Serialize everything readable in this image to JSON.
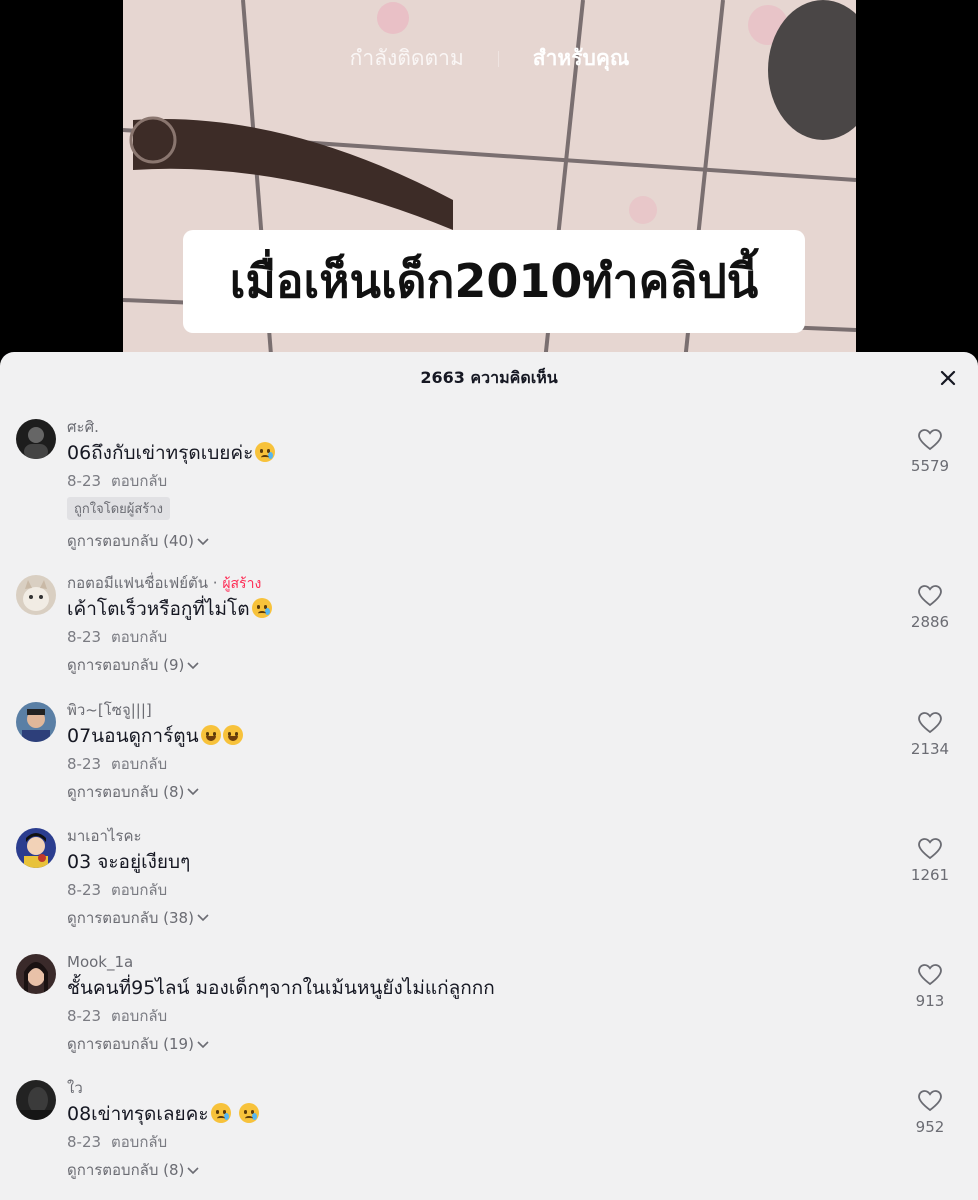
{
  "top_tabs": {
    "following": "กำลังติดตาม",
    "for_you": "สำหรับคุณ"
  },
  "video": {
    "caption": "เมื่อเห็นเด็ก2010ทำคลิปนี้"
  },
  "comments_panel": {
    "title": "2663 ความคิดเห็น",
    "comments": [
      {
        "username": "ศะศิ.",
        "creator": "",
        "text": "06ถึงกับเข่าทรุดเบยค่ะ",
        "emojis": [
          "crying-face"
        ],
        "date": "8-23",
        "reply_label": "ตอบกลับ",
        "badge": "ถูกใจโดยผู้สร้าง",
        "view_replies": "ดูการตอบกลับ (40)",
        "likes": "5579"
      },
      {
        "username": "กอตอมีแฟนชื่อเฟย์ตัน ·",
        "creator": "ผู้สร้าง",
        "text": "เค้าโตเร็วหรือกูที่ไม่โต",
        "emojis": [
          "crying-face"
        ],
        "date": "8-23",
        "reply_label": "ตอบกลับ",
        "badge": "",
        "view_replies": "ดูการตอบกลับ (9)",
        "likes": "2886"
      },
      {
        "username": "พิว~[โซจู|||]",
        "creator": "",
        "text": "07นอนดูการ์ตูน",
        "emojis": [
          "laughing-face",
          "laughing-face"
        ],
        "date": "8-23",
        "reply_label": "ตอบกลับ",
        "badge": "",
        "view_replies": "ดูการตอบกลับ (8)",
        "likes": "2134"
      },
      {
        "username": "มาเอาไรคะ",
        "creator": "",
        "text": "03 จะอยู่เงียบๆ",
        "emojis": [],
        "date": "8-23",
        "reply_label": "ตอบกลับ",
        "badge": "",
        "view_replies": "ดูการตอบกลับ (38)",
        "likes": "1261"
      },
      {
        "username": "Mook_1a",
        "creator": "",
        "text": "ชั้นคนที่95ไลน์ มองเด็กๆจากในเม้นหนูยังไม่แก่ลูกกก",
        "emojis": [],
        "date": "8-23",
        "reply_label": "ตอบกลับ",
        "badge": "",
        "view_replies": "ดูการตอบกลับ (19)",
        "likes": "913"
      },
      {
        "username": "ใว",
        "creator": "",
        "text": "08เข่าทรุดเลยคะ",
        "emojis": [
          "crying-face",
          "crying-face"
        ],
        "date": "8-23",
        "reply_label": "ตอบกลับ",
        "badge": "",
        "view_replies": "ดูการตอบกลับ (8)",
        "likes": "952"
      }
    ]
  },
  "colors": {
    "creator_accent": "#fe2c55",
    "sheet_bg": "#f1f1f2",
    "text": "#161823",
    "muted": "#6b6c73"
  }
}
